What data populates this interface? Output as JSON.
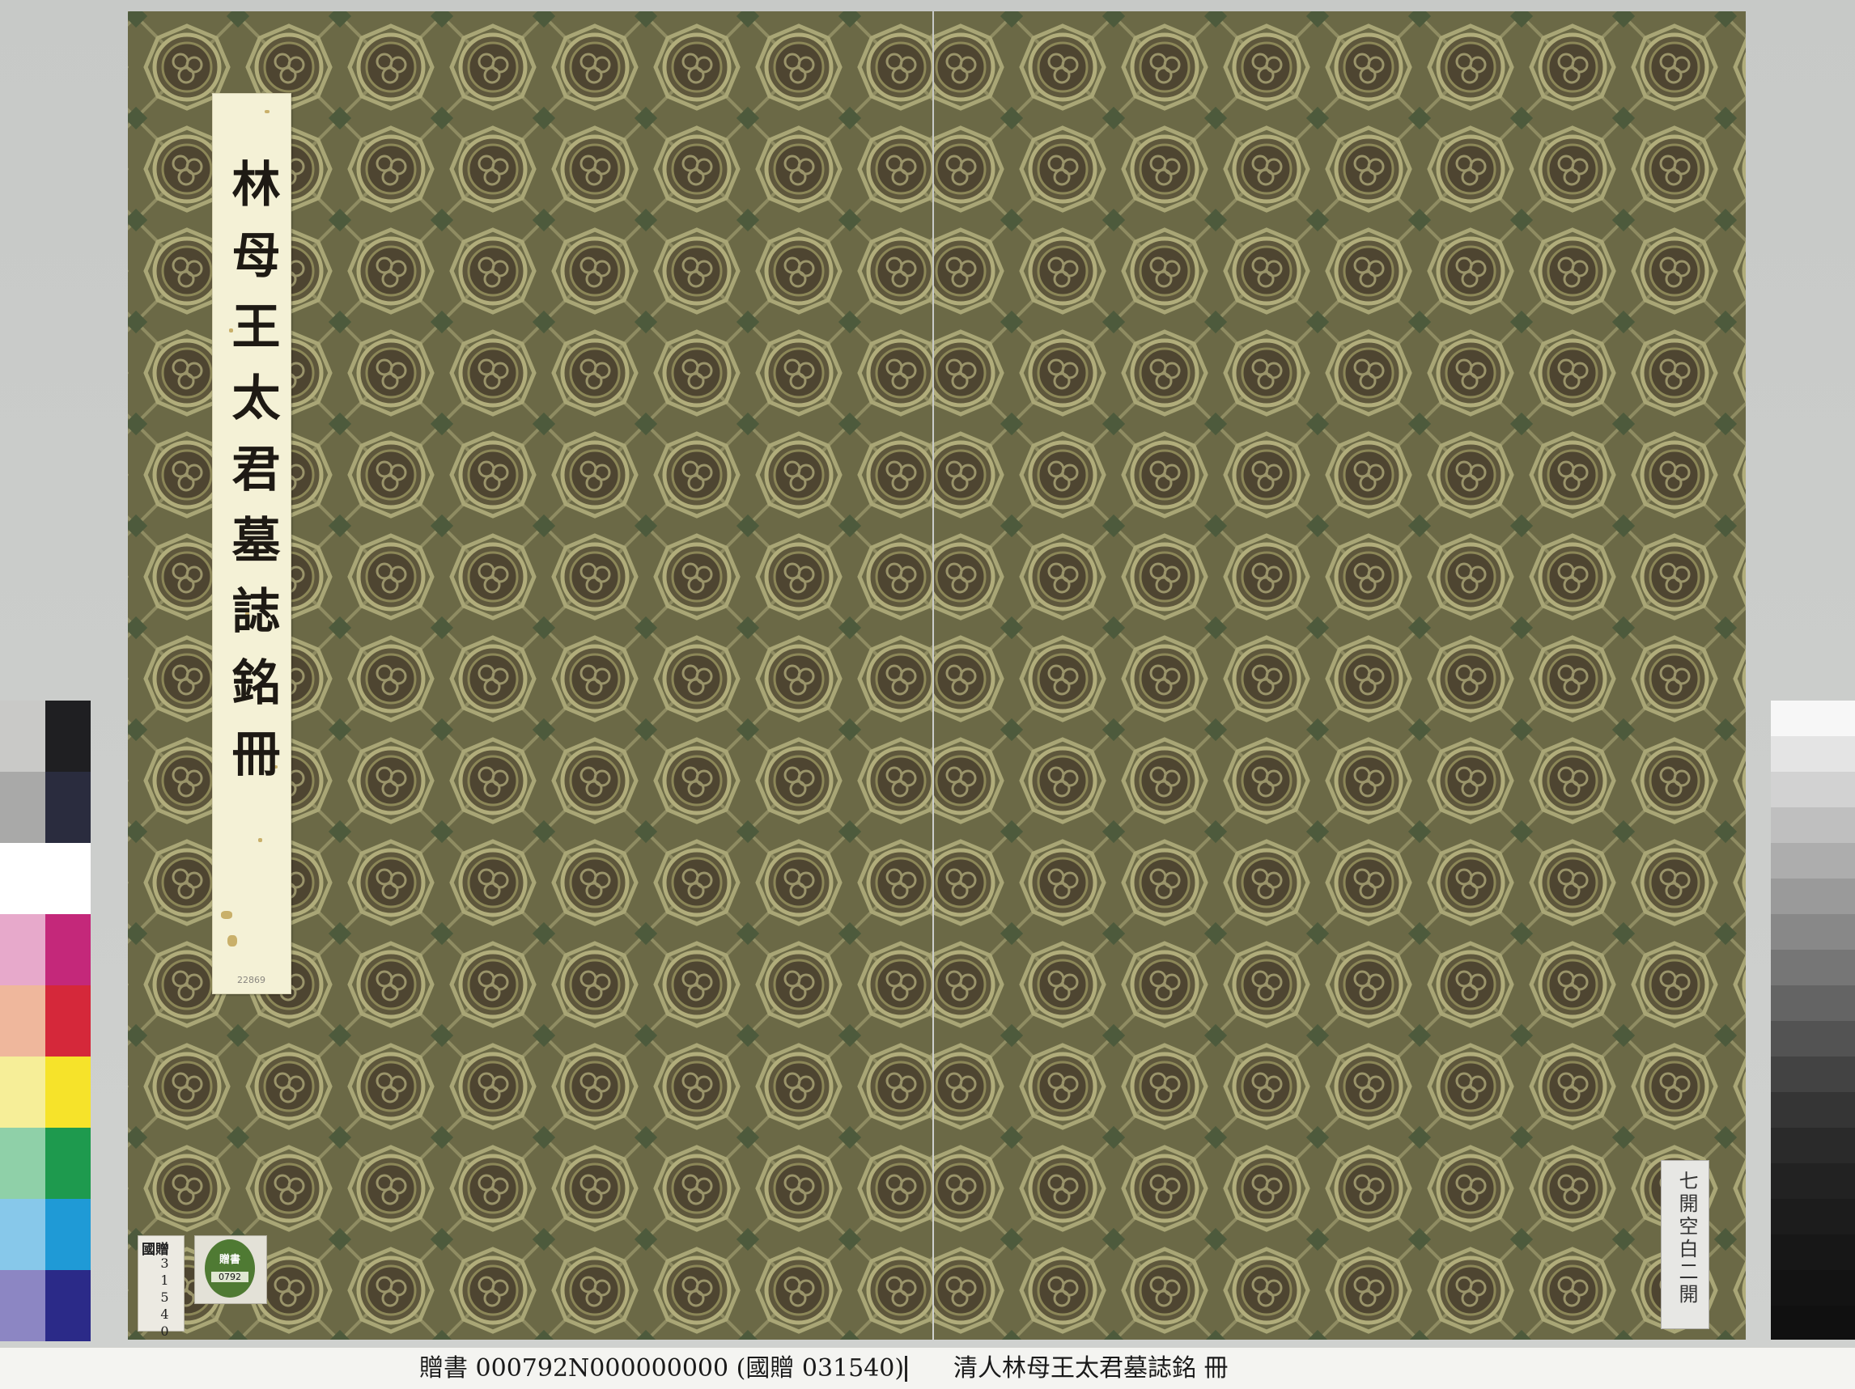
{
  "artwork": {
    "title_slip_text": "林母王太君墓誌銘冊",
    "title_slip_small_mark": "22869",
    "label_guo_heading": "國贈",
    "label_guo_number": "31540",
    "label_zeng_text": "贈書",
    "label_zeng_number": "0792",
    "label_right_text": "七開空白二開",
    "brocade_color": "#6d6b48"
  },
  "caption": {
    "identifier": "贈書 000792N000000000 (國贈 031540)",
    "title": "清人林母王太君墓誌銘 冊"
  }
}
